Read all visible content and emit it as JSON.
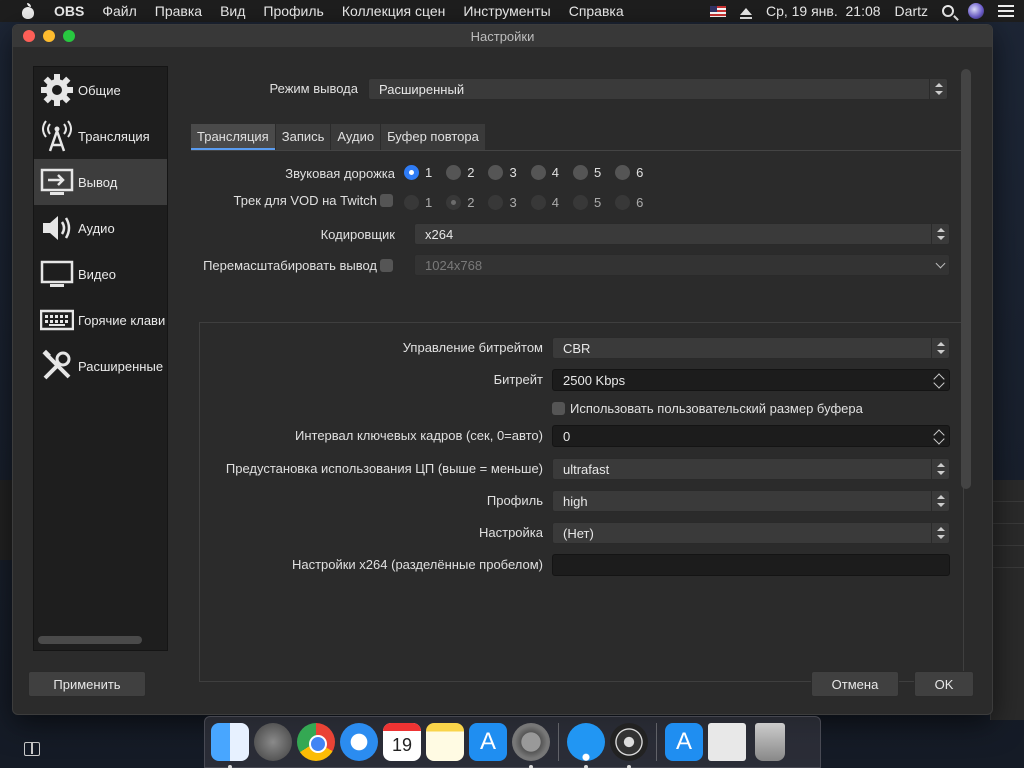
{
  "menubar": {
    "app": "OBS",
    "items": [
      "Файл",
      "Правка",
      "Вид",
      "Профиль",
      "Коллекция сцен",
      "Инструменты",
      "Справка"
    ],
    "datetime": "Ср, 19 янв.  21:08",
    "user": "Dartz"
  },
  "window": {
    "title": "Настройки"
  },
  "sidebar": {
    "items": [
      {
        "label": "Общие",
        "icon": "gear-icon"
      },
      {
        "label": "Трансляция",
        "icon": "broadcast-icon"
      },
      {
        "label": "Вывод",
        "icon": "output-icon"
      },
      {
        "label": "Аудио",
        "icon": "speaker-icon"
      },
      {
        "label": "Видео",
        "icon": "monitor-icon"
      },
      {
        "label": "Горячие клави",
        "icon": "keyboard-icon"
      },
      {
        "label": "Расширенные",
        "icon": "tools-icon"
      }
    ],
    "active_index": 2
  },
  "output_mode": {
    "label": "Режим вывода",
    "value": "Расширенный"
  },
  "tabs": [
    "Трансляция",
    "Запись",
    "Аудио",
    "Буфер повтора"
  ],
  "audio_track": {
    "label": "Звуковая дорожка",
    "options": [
      "1",
      "2",
      "3",
      "4",
      "5",
      "6"
    ],
    "selected": "1"
  },
  "vod_track": {
    "label": "Трек для VOD на Twitch",
    "options": [
      "1",
      "2",
      "3",
      "4",
      "5",
      "6"
    ],
    "selected": "2"
  },
  "encoder": {
    "label": "Кодировщик",
    "value": "x264"
  },
  "rescale": {
    "label": "Перемасштабировать вывод",
    "value": "1024x768"
  },
  "rate_control": {
    "label": "Управление битрейтом",
    "value": "CBR"
  },
  "bitrate": {
    "label": "Битрейт",
    "value": "2500 Kbps"
  },
  "custom_buffer": {
    "label": "Использовать пользовательский размер буфера"
  },
  "keyframe": {
    "label": "Интервал ключевых кадров (сек, 0=авто)",
    "value": "0"
  },
  "cpu_preset": {
    "label": "Предустановка использования ЦП (выше = меньше)",
    "value": "ultrafast"
  },
  "profile": {
    "label": "Профиль",
    "value": "high"
  },
  "tune": {
    "label": "Настройка",
    "value": "(Нет)"
  },
  "x264_opts": {
    "label": "Настройки x264 (разделённые пробелом)",
    "value": ""
  },
  "buttons": {
    "apply": "Применить",
    "cancel": "Отмена",
    "ok": "OK"
  },
  "colors": {
    "accent": "#2f7cf6",
    "window_bg": "#2b2b2b",
    "sidebar_bg": "#1e1e1e"
  },
  "dock": {
    "calendar_day": "19"
  }
}
